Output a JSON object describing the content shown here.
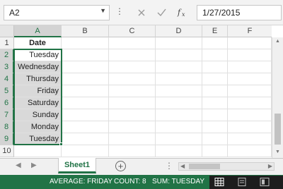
{
  "formula_bar": {
    "name_box": "A2",
    "formula": "1/27/2015",
    "icons": [
      "cancel-icon",
      "enter-icon",
      "insert-function-icon"
    ]
  },
  "columns": [
    "A",
    "B",
    "C",
    "D",
    "E",
    "F"
  ],
  "rows": [
    "1",
    "2",
    "3",
    "4",
    "5",
    "6",
    "7",
    "8",
    "9",
    "10"
  ],
  "column_a": {
    "header": "Date",
    "values": [
      "Tuesday",
      "Wednesday",
      "Thursday",
      "Friday",
      "Saturday",
      "Sunday",
      "Monday",
      "Tuesday"
    ]
  },
  "sheet_tabs": {
    "active": "Sheet1",
    "add_icon": "plus-circle-icon"
  },
  "status_bar": {
    "average": "AVERAGE: FRIDAY",
    "count": "COUNT: 8",
    "sum": "SUM: TUESDAY"
  },
  "colors": {
    "accent": "#217346",
    "selection_fill": "#d9d9d9",
    "status_bar": "#217346"
  }
}
